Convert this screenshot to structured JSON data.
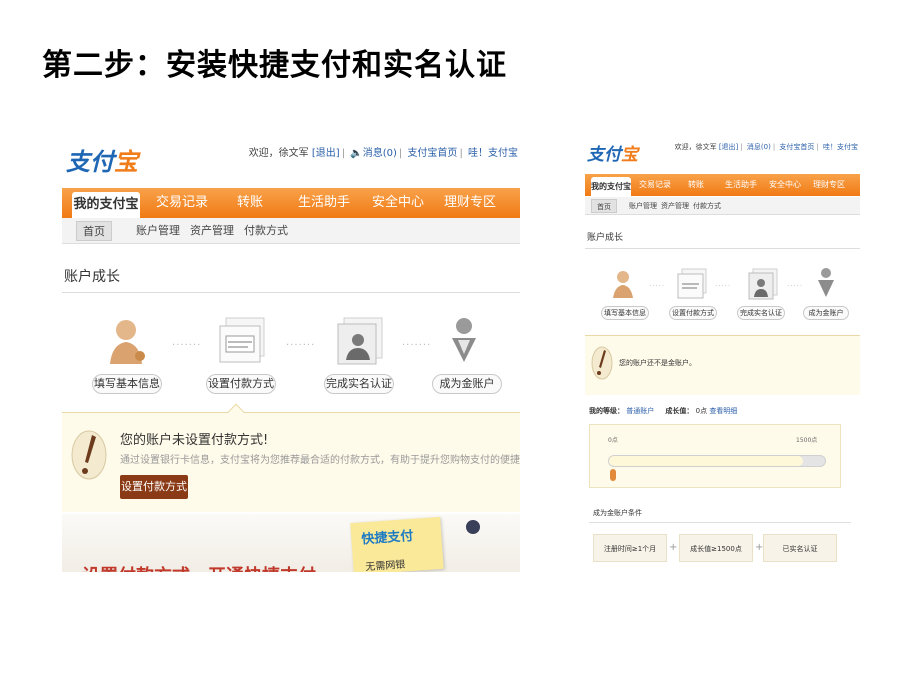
{
  "slide": {
    "title": "第二步：安装快捷支付和实名认证"
  },
  "left": {
    "logo": {
      "main": "支付",
      "accent": "宝"
    },
    "toplinks": {
      "welcome": "欢迎，徐文军",
      "logout": "[退出]",
      "messages": "消息(0)",
      "home": "支付宝首页",
      "help": "哇！支付宝"
    },
    "nav": [
      "我的支付宝",
      "交易记录",
      "转账",
      "生活助手",
      "安全中心",
      "理财专区"
    ],
    "subnav": [
      "首页",
      "账户管理",
      "资产管理",
      "付款方式"
    ],
    "section_title": "账户成长",
    "steps": [
      "填写基本信息",
      "设置付款方式",
      "完成实名认证",
      "成为金账户"
    ],
    "notice": {
      "title": "您的账户未设置付款方式!",
      "desc": "通过设置银行卡信息，支付宝将为您推荐最合适的付款方式，有助于提升您购物支付的便捷性和安全性。",
      "button": "设置付款方式"
    },
    "promo": {
      "text": "设置付款方式，开通快捷支付",
      "sticky_title": "快捷支付",
      "sticky_sub": "无需网银"
    }
  },
  "right": {
    "logo": {
      "main": "支付",
      "accent": "宝"
    },
    "toplinks": {
      "welcome": "欢迎，徐文军",
      "logout": "[退出]",
      "messages": "消息(0)",
      "home": "支付宝首页",
      "help": "哇！支付宝"
    },
    "nav": [
      "我的支付宝",
      "交易记录",
      "转账",
      "生活助手",
      "安全中心",
      "理财专区"
    ],
    "subnav": [
      "首页",
      "账户管理",
      "资产管理",
      "付款方式"
    ],
    "section_title": "账户成长",
    "steps": [
      "填写基本信息",
      "设置付款方式",
      "完成实名认证",
      "成为金账户"
    ],
    "notice": {
      "title": "您的账户还不是金账户。"
    },
    "level": {
      "label": "我的等级：",
      "value": "普通账户",
      "growth_label": "成长值：",
      "growth_value": "0点",
      "growth_link": "查看明细"
    },
    "progress": {
      "min_label": "0点",
      "max_label": "1500点",
      "marker": "0",
      "fraction": 0.0
    },
    "conditions": {
      "title": "成为金账户条件",
      "items": [
        "注册时间≥1个月",
        "成长值≥1500点",
        "已实名认证"
      ]
    }
  },
  "colors": {
    "orange": "#f07a14",
    "brand_blue": "#1f66b4",
    "notice_bg": "#fffbea",
    "button_brown": "#8b3a16"
  },
  "icons": [
    "person-icon",
    "card-icon",
    "id-card-icon",
    "gold-user-icon",
    "exclamation-icon",
    "speaker-icon",
    "pushpin-icon"
  ]
}
